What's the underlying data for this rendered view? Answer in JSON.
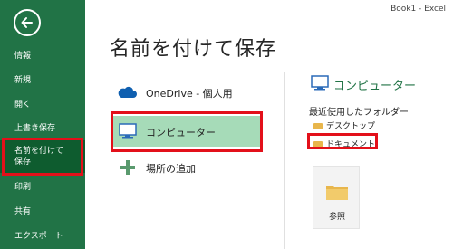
{
  "window": {
    "title": "Book1 - Excel"
  },
  "sidebar": {
    "items": [
      {
        "label": "情報"
      },
      {
        "label": "新規"
      },
      {
        "label": "開く"
      },
      {
        "label": "上書き保存"
      },
      {
        "label_line1": "名前を付けて",
        "label_line2": "保存"
      },
      {
        "label": "印刷"
      },
      {
        "label": "共有"
      },
      {
        "label": "エクスポート"
      }
    ]
  },
  "main": {
    "title": "名前を付けて保存",
    "locations": [
      {
        "label": "OneDrive - 個人用",
        "icon": "cloud-icon"
      },
      {
        "label": "コンピューター",
        "icon": "computer-icon"
      },
      {
        "label": "場所の追加",
        "icon": "plus-icon"
      }
    ]
  },
  "right_panel": {
    "title": "コンピューター",
    "recent_label": "最近使用したフォルダー",
    "folders": [
      {
        "label": "デスクトップ",
        "icon": "folder-icon"
      },
      {
        "label": "ドキュメント",
        "icon": "folder-icon"
      }
    ],
    "browse_label": "参照"
  },
  "colors": {
    "sidebar": "#217346",
    "accent": "#217346",
    "highlight": "#e3101a",
    "active": "#a6dbb8"
  }
}
